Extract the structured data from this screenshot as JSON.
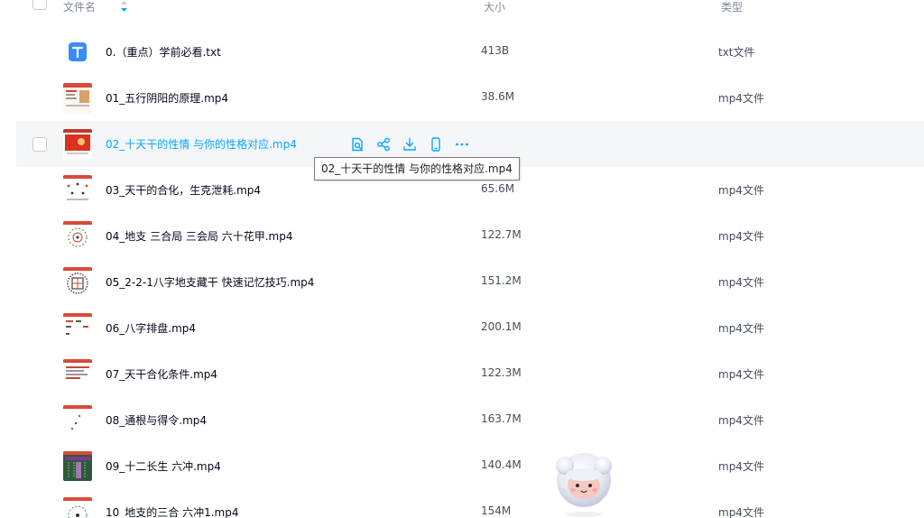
{
  "header": {
    "name_col": "文件名",
    "size_col": "大小",
    "type_col": "类型"
  },
  "colors": {
    "accent": "#06a7ff",
    "hover_bg": "#f5f6fa",
    "text": "#03081a",
    "muted": "#818999"
  },
  "files": [
    {
      "name": "0.（重点）学前必看.txt",
      "size": "413B",
      "type": "txt文件",
      "icon": "txt-file-icon"
    },
    {
      "name": "01_五行阴阳的原理.mp4",
      "size": "38.6M",
      "type": "mp4文件",
      "icon": "video-thumbnail"
    },
    {
      "name": "02_十天干的性情 与你的性格对应.mp4",
      "size": "",
      "type": "",
      "icon": "video-thumbnail"
    },
    {
      "name": "03_天干的合化，生克泄耗.mp4",
      "size": "65.6M",
      "type": "mp4文件",
      "icon": "video-thumbnail"
    },
    {
      "name": "04_地支 三合局 三会局 六十花甲.mp4",
      "size": "122.7M",
      "type": "mp4文件",
      "icon": "video-thumbnail"
    },
    {
      "name": "05_2-2-1八字地支藏干 快速记忆技巧.mp4",
      "size": "151.2M",
      "type": "mp4文件",
      "icon": "video-thumbnail"
    },
    {
      "name": "06_八字排盘.mp4",
      "size": "200.1M",
      "type": "mp4文件",
      "icon": "video-thumbnail"
    },
    {
      "name": "07_天干合化条件.mp4",
      "size": "122.3M",
      "type": "mp4文件",
      "icon": "video-thumbnail"
    },
    {
      "name": "08_通根与得令.mp4",
      "size": "163.7M",
      "type": "mp4文件",
      "icon": "video-thumbnail"
    },
    {
      "name": "09_十二长生 六冲.mp4",
      "size": "140.4M",
      "type": "mp4文件",
      "icon": "video-thumbnail"
    },
    {
      "name": "10_地支的三合 六冲1.mp4",
      "size": "154M",
      "type": "mp4文件",
      "icon": "video-thumbnail"
    }
  ],
  "hover_row": 2,
  "tooltip": "02_十天干的性情 与你的性格对应.mp4",
  "row_actions": [
    "preview-icon",
    "share-icon",
    "download-icon",
    "send-to-phone-icon",
    "more-icon"
  ]
}
